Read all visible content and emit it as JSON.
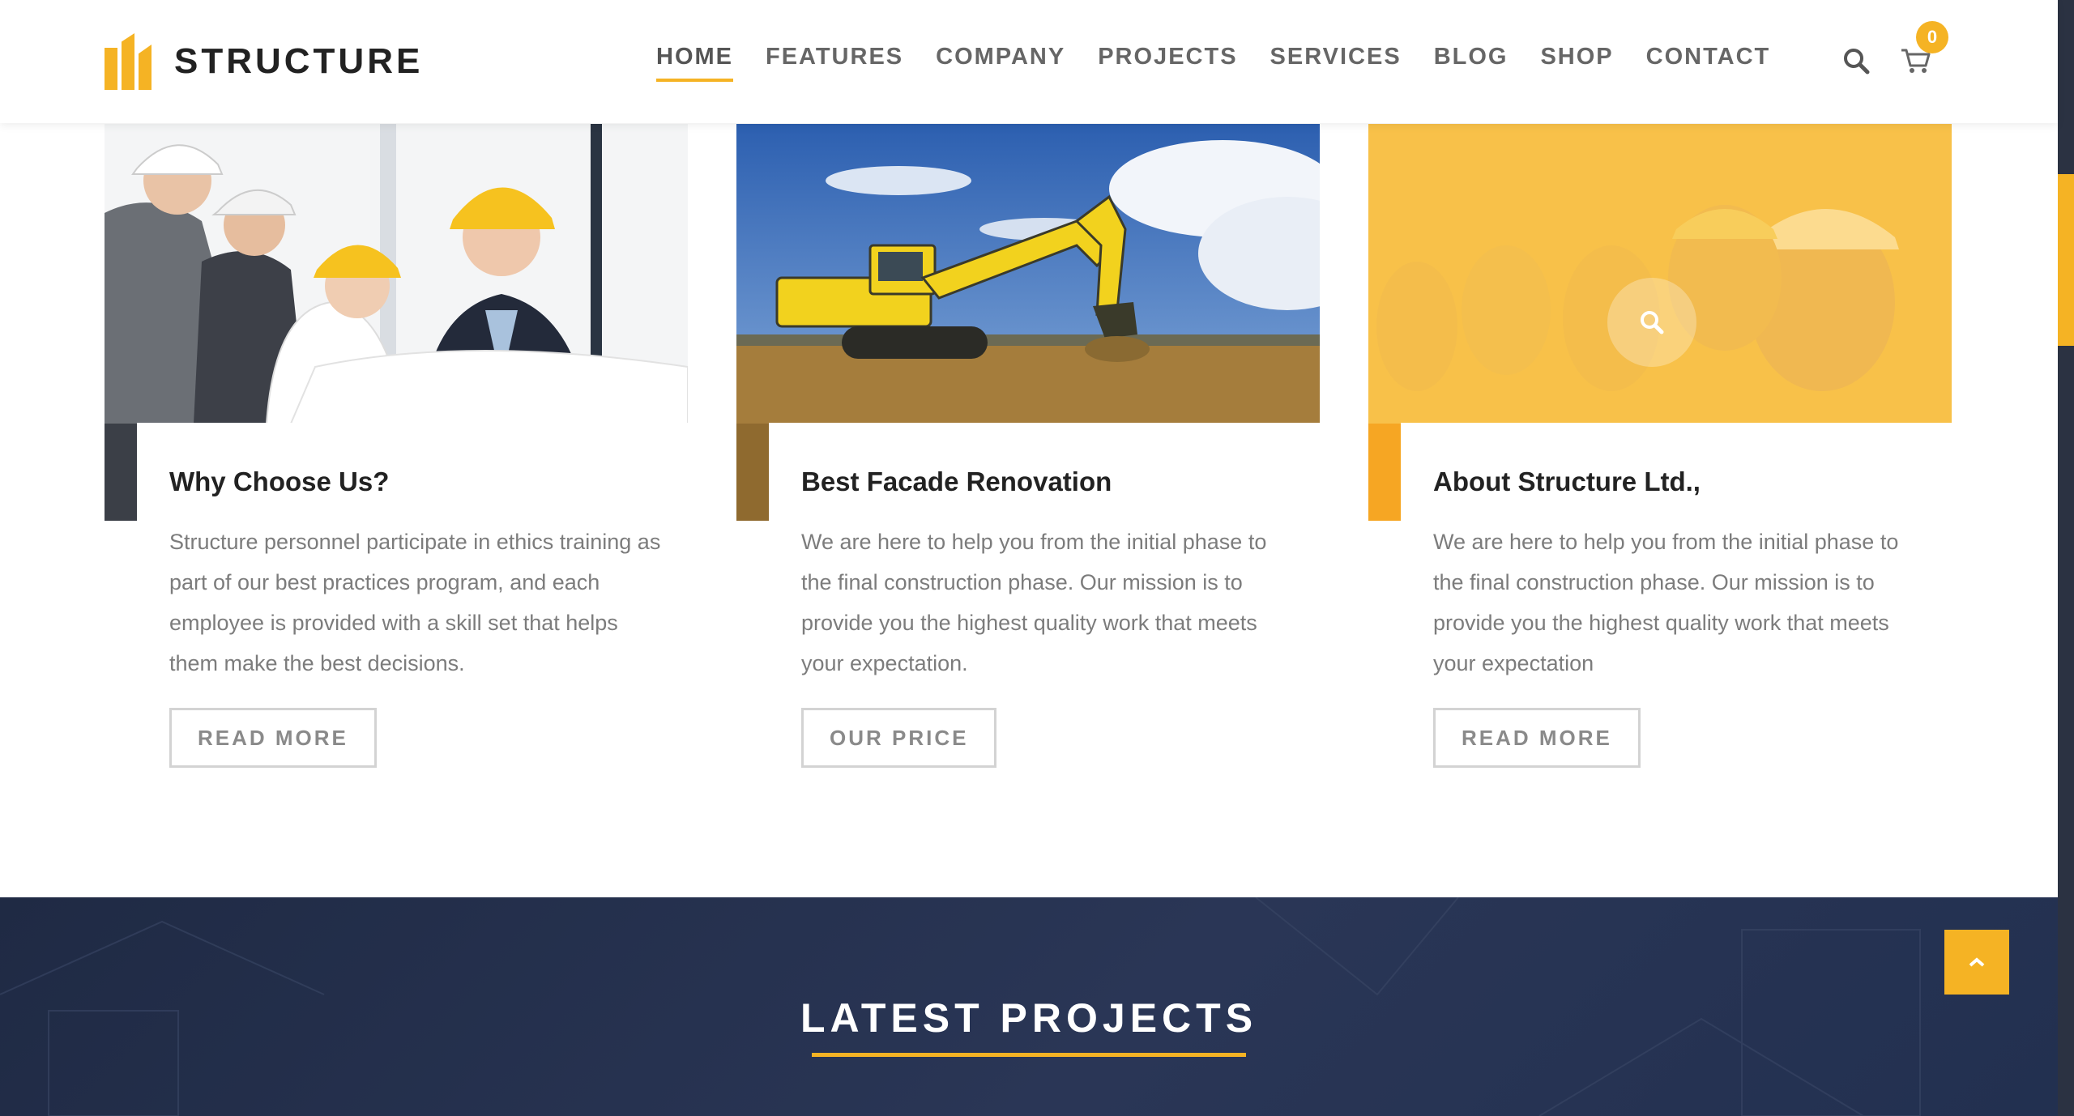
{
  "brand": {
    "name": "STRUCTURE",
    "accent": "#f5b324"
  },
  "nav": {
    "items": [
      {
        "label": "HOME",
        "active": true
      },
      {
        "label": "FEATURES"
      },
      {
        "label": "COMPANY"
      },
      {
        "label": "PROJECTS"
      },
      {
        "label": "SERVICES"
      },
      {
        "label": "BLOG"
      },
      {
        "label": "SHOP"
      },
      {
        "label": "CONTACT"
      }
    ],
    "cart_count": "0"
  },
  "cards": [
    {
      "title": "Why Choose Us?",
      "text": "Structure personnel participate in ethics training as part of our best practices program, and each employee is provided with a skill set that helps them make the best decisions.",
      "button": "READ MORE"
    },
    {
      "title": "Best Facade Renovation",
      "text": "We are here to help you from the initial phase to the final construction phase. Our mission is to provide you the highest quality work that meets your expectation.",
      "button": "OUR PRICE"
    },
    {
      "title": "About Structure Ltd.,",
      "text": "We are here to help you from the initial phase to the final construction phase. Our mission is to provide you the highest quality work that meets your expectation",
      "button": "READ MORE"
    }
  ],
  "section": {
    "title": "LATEST PROJECTS",
    "background": "#1f2a44"
  }
}
